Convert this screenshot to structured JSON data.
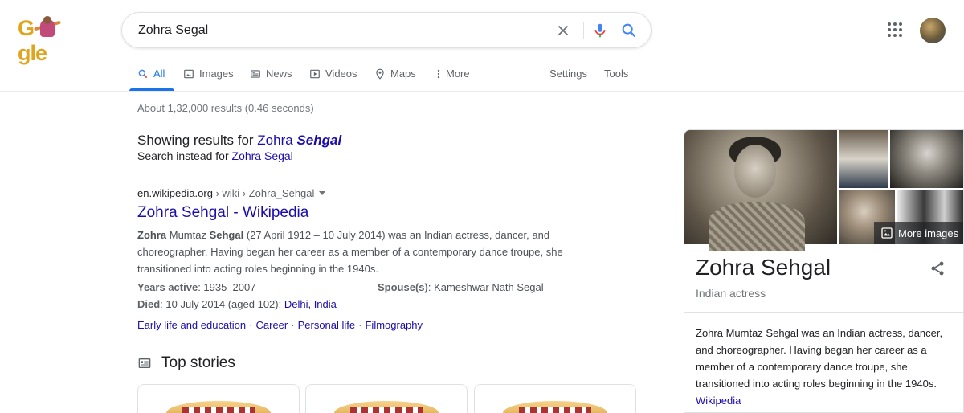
{
  "logo": {
    "text_g": "G",
    "text_gle": "gle"
  },
  "search": {
    "query": "Zohra Segal"
  },
  "tabs": [
    {
      "label": "All"
    },
    {
      "label": "Images"
    },
    {
      "label": "News"
    },
    {
      "label": "Videos"
    },
    {
      "label": "Maps"
    },
    {
      "label": "More"
    }
  ],
  "tools": {
    "settings": "Settings",
    "tools": "Tools"
  },
  "stats": "About 1,32,000 results (0.46 seconds)",
  "spelling": {
    "showing_prefix": "Showing results for ",
    "showing_plain": "Zohra ",
    "showing_bold": "Sehgal",
    "instead_prefix": "Search instead for ",
    "instead_link": "Zohra Segal"
  },
  "result": {
    "domain": "en.wikipedia.org",
    "path": " › wiki › Zohra_Sehgal",
    "title": "Zohra Sehgal - Wikipedia",
    "snippet_b1": "Zohra",
    "snippet_t1": " Mumtaz ",
    "snippet_b2": "Sehgal",
    "snippet_t2": " (27 April 1912 – 10 July 2014) was an Indian actress, dancer, and choreographer. Having began her career as a member of a contemporary dance troupe, she transitioned into acting roles beginning in the 1940s.",
    "years_active_label": "Years active",
    "years_active_value": ": 1935–2007",
    "spouse_label": "Spouse(s)",
    "spouse_value": ": Kameshwar Nath Segal",
    "died_label": "Died",
    "died_value": ": 10 July 2014 (aged 102); ",
    "died_place": "Delhi, India",
    "sitelinks": [
      "Early life and education",
      "Career",
      "Personal life",
      "Filmography"
    ],
    "sep": "·"
  },
  "top_stories": {
    "title": "Top stories"
  },
  "knowledge_panel": {
    "more_images": "More images",
    "title": "Zohra Sehgal",
    "subtitle": "Indian actress",
    "description": "Zohra Mumtaz Sehgal was an Indian actress, dancer, and choreographer. Having began her career as a member of a contemporary dance troupe, she transitioned into acting roles beginning in the 1940s.",
    "source": "Wikipedia"
  },
  "colors": {
    "accent": "#1a73e8",
    "link": "#1a0dab",
    "text": "#202124",
    "muted": "#70757a"
  }
}
